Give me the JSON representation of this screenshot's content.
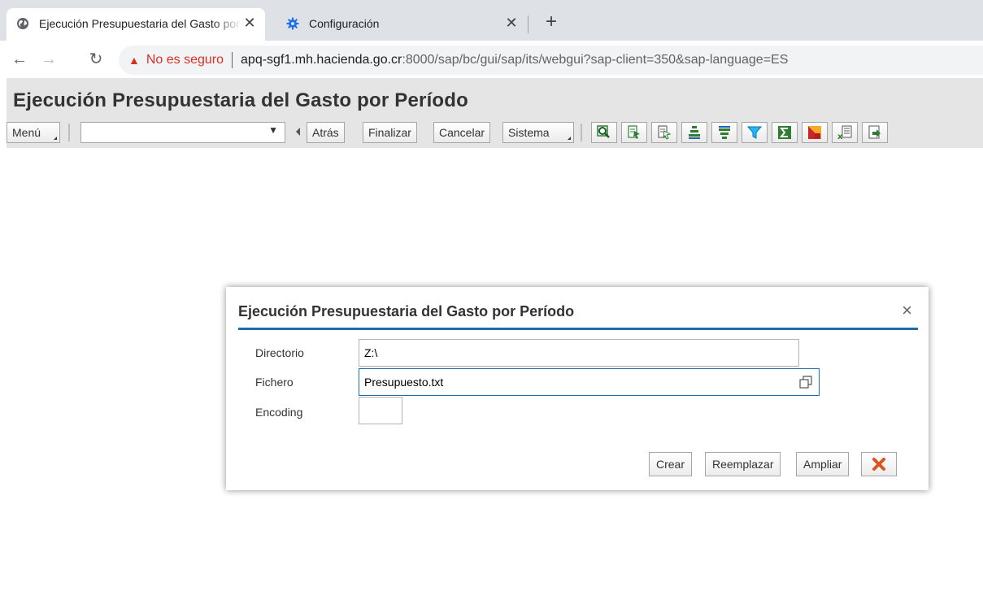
{
  "browser": {
    "tabs": [
      {
        "title": "Ejecución Presupuestaria del Gasto por Período",
        "icon": "globe-icon",
        "active": true
      },
      {
        "title": "Configuración",
        "icon": "gear-icon",
        "active": false
      }
    ],
    "close_glyph": "✕",
    "new_tab_glyph": "+",
    "security_label": "No es seguro",
    "url_host": "apq-sgf1.mh.hacienda.go.cr",
    "url_rest": ":8000/sap/bc/gui/sap/its/webgui?sap-client=350&sap-language=ES"
  },
  "app": {
    "title": "Ejecución Presupuestaria del Gasto por Período",
    "toolbar": {
      "menu_label": "Menú",
      "command_value": "",
      "back_label": "Atrás",
      "finish_label": "Finalizar",
      "cancel_label": "Cancelar",
      "system_label": "Sistema",
      "icon_buttons": [
        "find-icon",
        "select-icon",
        "deselect-icon",
        "sort-ascending-icon",
        "sort-descending-icon",
        "filter-icon",
        "sum-icon",
        "subtotal-icon",
        "export-excel-icon",
        "export-local-file-icon"
      ]
    }
  },
  "dialog": {
    "title": "Ejecución Presupuestaria del Gasto por Período",
    "close_glyph": "×",
    "fields": {
      "directorio": {
        "label": "Directorio",
        "value": "Z:\\"
      },
      "fichero": {
        "label": "Fichero",
        "value": "Presupuesto.txt"
      },
      "encoding": {
        "label": "Encoding",
        "value": ""
      }
    },
    "buttons": {
      "create": "Crear",
      "replace": "Reemplazar",
      "extend": "Ampliar"
    }
  },
  "colors": {
    "accent": "#1b6ea8",
    "warning": "#d93025",
    "cancel_icon": "#d9541e"
  }
}
